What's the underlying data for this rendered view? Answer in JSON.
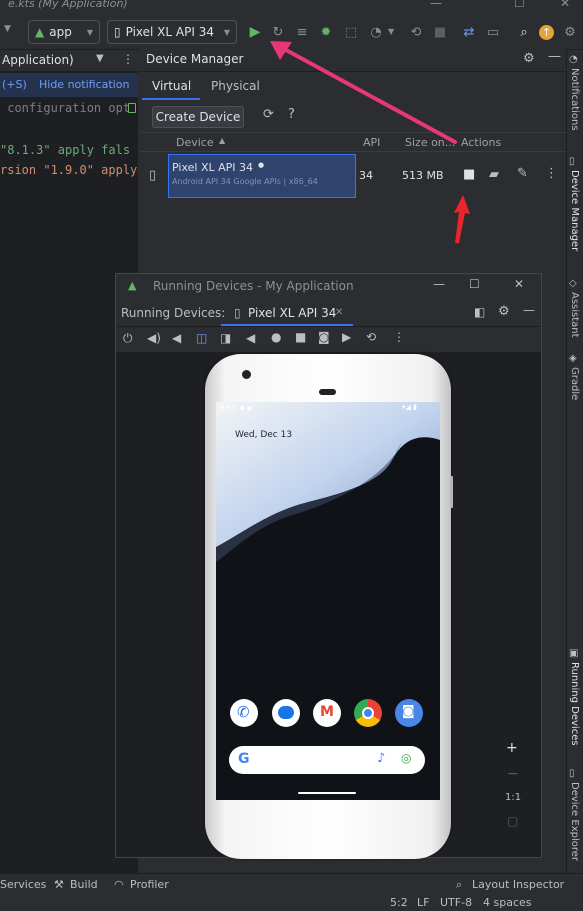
{
  "window_title": "e.kts (My Application)",
  "toolbar": {
    "run_config": "app",
    "device": "Pixel XL API 34"
  },
  "notification": {
    "shortcut": "(+S)",
    "hide_label": "Hide notification",
    "prefix": "Application)"
  },
  "code_lines": [
    " configuration opt",
    "\"8.1.3\" apply fals",
    "rsion \"1.9.0\" apply"
  ],
  "device_manager": {
    "title": "Device Manager",
    "tabs": [
      "Virtual",
      "Physical"
    ],
    "create_label": "Create Device",
    "help": "?",
    "columns": [
      "Device",
      "API",
      "Size on...",
      "Actions"
    ],
    "row": {
      "name": "Pixel XL API 34",
      "subtitle": "Android API 34 Google APIs | x86_64",
      "api": "34",
      "size": "513 MB"
    }
  },
  "right_tools": [
    "Notifications",
    "Device Manager",
    "Assistant",
    "Gradle",
    "Running Devices",
    "Device Explorer"
  ],
  "running_devices": {
    "window_title": "Running Devices - My Application",
    "label": "Running Devices:",
    "tab": "Pixel XL API 34",
    "zoom_in": "+",
    "zoom_out": "−",
    "ratio": "1:1"
  },
  "phone": {
    "time": "6:57",
    "date": "Wed, Dec 13",
    "search_letter": "G"
  },
  "status_bar": {
    "services": "Services",
    "build": "Build",
    "profiler": "Profiler",
    "layout_inspector": "Layout Inspector",
    "position": "5:2",
    "line_sep": "LF",
    "encoding": "UTF-8",
    "indent": "4 spaces"
  },
  "colors": {
    "arrow": "#e8367a",
    "run_green": "#5fb865",
    "accent_blue": "#3574f0"
  }
}
